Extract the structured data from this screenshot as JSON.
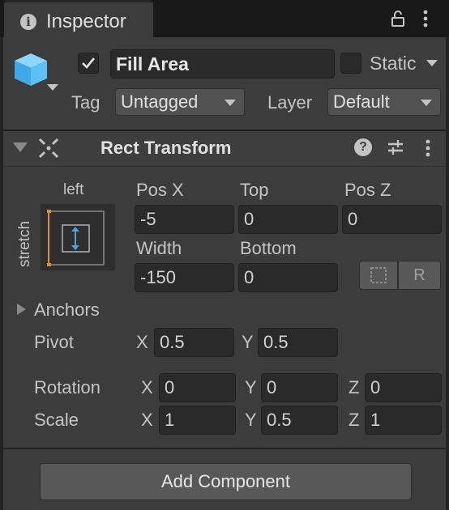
{
  "tab": {
    "title": "Inspector"
  },
  "header": {
    "name": "Fill Area",
    "static_label": "Static",
    "tag_label": "Tag",
    "tag_value": "Untagged",
    "layer_label": "Layer",
    "layer_value": "Default"
  },
  "component": {
    "title": "Rect Transform",
    "anchor_h": "left",
    "anchor_v": "stretch",
    "fields": {
      "pos_x_label": "Pos X",
      "pos_x": "-5",
      "top_label": "Top",
      "top": "0",
      "pos_z_label": "Pos Z",
      "pos_z": "0",
      "width_label": "Width",
      "width": "-150",
      "bottom_label": "Bottom",
      "bottom": "0"
    },
    "raw_label": "R",
    "anchors_label": "Anchors",
    "pivot": {
      "label": "Pivot",
      "x_label": "X",
      "x": "0.5",
      "y_label": "Y",
      "y": "0.5"
    },
    "rotation": {
      "label": "Rotation",
      "x_label": "X",
      "x": "0",
      "y_label": "Y",
      "y": "0",
      "z_label": "Z",
      "z": "0"
    },
    "scale": {
      "label": "Scale",
      "x_label": "X",
      "x": "1",
      "y_label": "Y",
      "y": "0.5",
      "z_label": "Z",
      "z": "1"
    }
  },
  "footer": {
    "add_component": "Add Component"
  },
  "colors": {
    "anchor_blue": "#4aa3e0",
    "anchor_orange": "#d89030"
  }
}
